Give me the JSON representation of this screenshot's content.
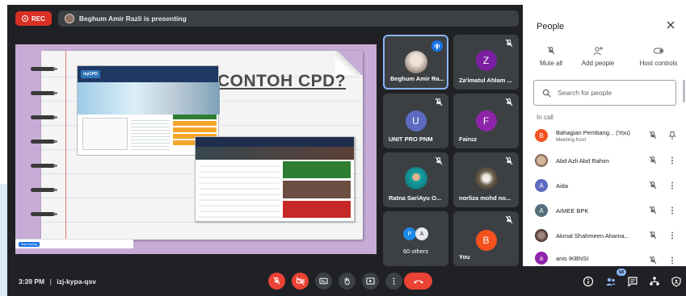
{
  "recording": {
    "label": "REC"
  },
  "presenting": {
    "text": "Beghum Amir Razli is presenting"
  },
  "slide": {
    "title": "CONTOH CPD?",
    "logo_text": "myCPD",
    "toast_action": "Stop sharing"
  },
  "tiles": [
    {
      "name": "Beghum Amir Ra...",
      "kind": "photo",
      "speaking": true,
      "muted": false
    },
    {
      "name": "Za'imatul Ahlam ...",
      "initial": "Z",
      "color": "#7b1fa2",
      "muted": true
    },
    {
      "name": "UNIT PRO PNM",
      "initial": "U",
      "color": "#5c6bc0",
      "muted": true
    },
    {
      "name": "Fairuz",
      "initial": "F",
      "color": "#8e24aa",
      "muted": true
    },
    {
      "name": "Ratna SariAyu O...",
      "kind": "photo",
      "muted": true
    },
    {
      "name": "norliza mohd no...",
      "kind": "photo",
      "muted": true
    },
    {
      "name": "60 others",
      "initials": [
        "P",
        "A"
      ],
      "muted": false
    },
    {
      "name": "You",
      "initial": "B",
      "color": "#f4511e",
      "muted": true
    }
  ],
  "bottom": {
    "time": "3:39 PM",
    "meeting_code": "izj-kypa-qsv",
    "separator": "|",
    "participants_badge": "68"
  },
  "people_panel": {
    "title": "People",
    "actions": {
      "mute_all": "Mute all",
      "add_people": "Add people",
      "host_controls": "Host controls"
    },
    "search_placeholder": "Search for people",
    "in_call_label": "In call",
    "people": [
      {
        "name": "Bahagian Pembang... (You)",
        "sub": "Meeting host",
        "initial": "B",
        "color": "#f4511e",
        "extra": "pin-icon"
      },
      {
        "name": "Abd Azli Abd Rahim",
        "initial": "",
        "color": "#8d6e63",
        "extra": "more-icon"
      },
      {
        "name": "Aida",
        "initial": "A",
        "color": "#5c6bc0",
        "extra": "more-icon"
      },
      {
        "name": "AIMEE BPK",
        "initial": "A",
        "color": "#546e7a",
        "extra": "more-icon"
      },
      {
        "name": "Akmal Shahmeen Ahama...",
        "initial": "",
        "color": "#5d4037",
        "extra": "more-icon"
      },
      {
        "name": "anis IKBNSI",
        "initial": "a",
        "color": "#8e24aa",
        "extra": "more-icon"
      }
    ]
  },
  "colors": {
    "rec_red": "#d93025",
    "end_call": "#ea4335",
    "meet_dark": "#202124",
    "tile_gray": "#3c4043",
    "accent_blue": "#8ab4f8"
  }
}
